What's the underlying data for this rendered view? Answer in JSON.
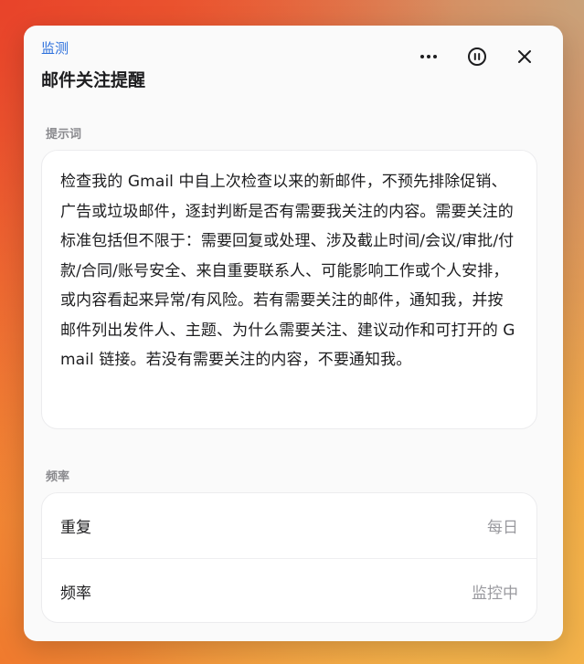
{
  "panel": {
    "eyebrow": "监测",
    "title": "邮件关注提醒"
  },
  "header_actions": {
    "more_icon": "more-horizontal-icon",
    "pause_icon": "pause-circle-icon",
    "close_icon": "close-icon"
  },
  "prompt": {
    "label": "提示词",
    "text": "检查我的 Gmail 中自上次检查以来的新邮件，不预先排除促销、广告或垃圾邮件，逐封判断是否有需要我关注的内容。需要关注的标准包括但不限于：需要回复或处理、涉及截止时间/会议/审批/付款/合同/账号安全、来自重要联系人、可能影响工作或个人安排，或内容看起来异常/有风险。若有需要关注的邮件，通知我，并按邮件列出发件人、主题、为什么需要关注、建议动作和可打开的 Gmail 链接。若没有需要关注的内容，不要通知我。"
  },
  "frequency": {
    "label": "频率",
    "rows": [
      {
        "label": "重复",
        "value": "每日"
      },
      {
        "label": "频率",
        "value": "监控中"
      }
    ]
  },
  "colors": {
    "accent": "#2b6fdc",
    "text": "#1d1d1f",
    "muted": "#8a8a8e"
  }
}
